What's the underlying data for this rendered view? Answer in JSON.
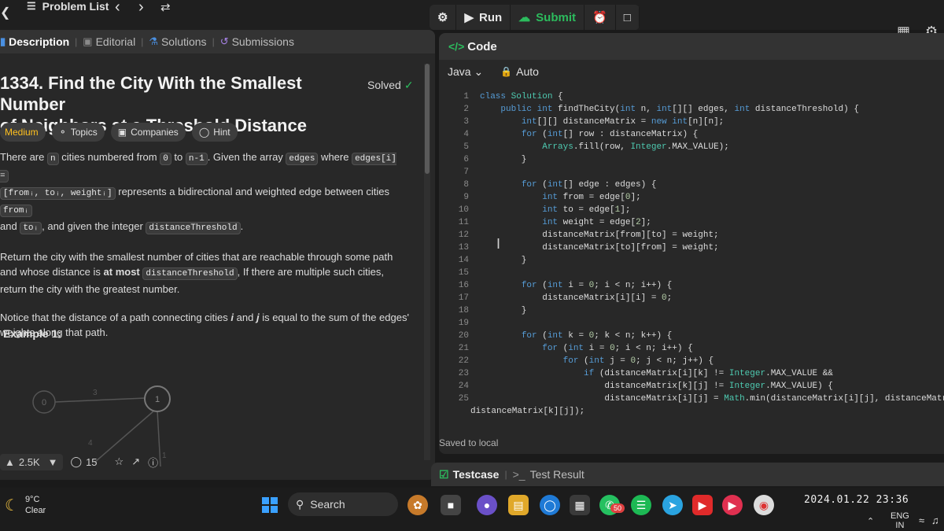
{
  "topbar": {
    "logo_icon": "leetcode-logo-icon",
    "problem_list": "Problem List",
    "run_label": "Run",
    "submit_label": "Submit"
  },
  "left_panel": {
    "tabs": [
      {
        "label": "Description",
        "icon": "description-icon"
      },
      {
        "label": "Editorial",
        "icon": "editorial-icon"
      },
      {
        "label": "Solutions",
        "icon": "flask-icon"
      },
      {
        "label": "Submissions",
        "icon": "history-icon"
      }
    ],
    "title_line1": "1334. Find the City With the Smallest Number",
    "title_line2": "of Neighbors at a Threshold Distance",
    "solved_label": "Solved",
    "chips": {
      "difficulty": "Medium",
      "topics": "Topics",
      "companies": "Companies",
      "hint": "Hint"
    },
    "p1": {
      "t1": "There are ",
      "c1": "n",
      "t2": " cities numbered from ",
      "c2": "0",
      "t3": " to ",
      "c3": "n-1",
      "t4": ". Given the array ",
      "c4": "edges",
      "t5": " where ",
      "c5": "edges[i] =",
      "c6": "[fromᵢ, toᵢ, weightᵢ]",
      "t6": " represents a bidirectional and weighted edge between cities ",
      "c7": "fromᵢ",
      "t7": "and ",
      "c8": "toᵢ",
      "t8": ", and given the integer ",
      "c9": "distanceThreshold",
      "t9": "."
    },
    "p2": {
      "t1": "Return the city with the smallest number of cities that are reachable through some path and whose distance is ",
      "bold": "at most",
      "t2": " ",
      "c1": "distanceThreshold",
      "t3": ", If there are multiple such cities, return the city with the greatest number."
    },
    "p3": {
      "t1": "Notice that the distance of a path connecting cities ",
      "i": "i",
      "t2": " and ",
      "j": "j",
      "t3": " is equal to the sum of the edges' weights along that path."
    },
    "example_title": "Example 1:",
    "graph": {
      "node_a": "0",
      "node_b": "1",
      "edge_label_1": "3",
      "edge_label_2": "4",
      "edge_label_3": "1"
    },
    "stats": {
      "likes": "2.5K",
      "comments": "15"
    }
  },
  "code_panel": {
    "header": "Code",
    "language": "Java",
    "mode": "Auto",
    "saved_text": "Saved to local",
    "lines": [
      {
        "n": "1"
      },
      {
        "n": "2"
      },
      {
        "n": "3"
      },
      {
        "n": "4"
      },
      {
        "n": "5"
      },
      {
        "n": "6"
      },
      {
        "n": "7"
      },
      {
        "n": "8"
      },
      {
        "n": "9"
      },
      {
        "n": "10"
      },
      {
        "n": "11"
      },
      {
        "n": "12"
      },
      {
        "n": "13"
      },
      {
        "n": "14"
      },
      {
        "n": "15"
      },
      {
        "n": "16"
      },
      {
        "n": "17"
      },
      {
        "n": "18"
      },
      {
        "n": "19"
      },
      {
        "n": "20"
      },
      {
        "n": "21"
      },
      {
        "n": "22"
      },
      {
        "n": "23"
      },
      {
        "n": "24"
      },
      {
        "n": "25"
      }
    ]
  },
  "testbar": {
    "testcase": "Testcase",
    "result": "Test Result"
  },
  "taskbar": {
    "temp": "9°C",
    "condition": "Clear",
    "search": "Search",
    "whatsapp_badge": "50",
    "datetime": "2024.01.22 23:36",
    "lang_line1": "ENG",
    "lang_line2": "IN"
  }
}
